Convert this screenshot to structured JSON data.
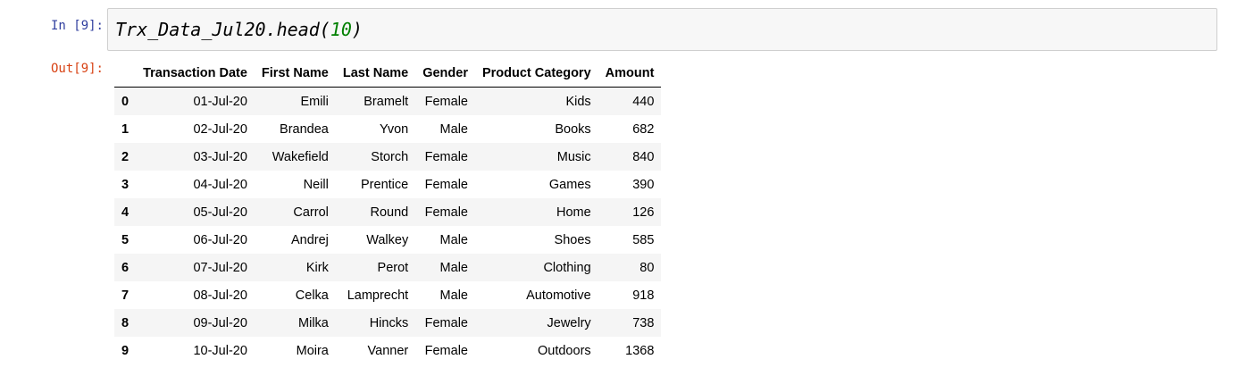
{
  "input_prompt": "In [9]:",
  "output_prompt": "Out[9]:",
  "code": {
    "prefix": "Trx_Data_Jul20.head(",
    "arg": "10",
    "suffix": ")"
  },
  "table": {
    "columns": [
      "",
      "Transaction Date",
      "First Name",
      "Last Name",
      "Gender",
      "Product Category",
      "Amount"
    ],
    "rows": [
      {
        "index": "0",
        "date": "01-Jul-20",
        "first": "Emili",
        "last": "Bramelt",
        "gender": "Female",
        "category": "Kids",
        "amount": "440"
      },
      {
        "index": "1",
        "date": "02-Jul-20",
        "first": "Brandea",
        "last": "Yvon",
        "gender": "Male",
        "category": "Books",
        "amount": "682"
      },
      {
        "index": "2",
        "date": "03-Jul-20",
        "first": "Wakefield",
        "last": "Storch",
        "gender": "Female",
        "category": "Music",
        "amount": "840"
      },
      {
        "index": "3",
        "date": "04-Jul-20",
        "first": "Neill",
        "last": "Prentice",
        "gender": "Female",
        "category": "Games",
        "amount": "390"
      },
      {
        "index": "4",
        "date": "05-Jul-20",
        "first": "Carrol",
        "last": "Round",
        "gender": "Female",
        "category": "Home",
        "amount": "126"
      },
      {
        "index": "5",
        "date": "06-Jul-20",
        "first": "Andrej",
        "last": "Walkey",
        "gender": "Male",
        "category": "Shoes",
        "amount": "585"
      },
      {
        "index": "6",
        "date": "07-Jul-20",
        "first": "Kirk",
        "last": "Perot",
        "gender": "Male",
        "category": "Clothing",
        "amount": "80"
      },
      {
        "index": "7",
        "date": "08-Jul-20",
        "first": "Celka",
        "last": "Lamprecht",
        "gender": "Male",
        "category": "Automotive",
        "amount": "918"
      },
      {
        "index": "8",
        "date": "09-Jul-20",
        "first": "Milka",
        "last": "Hincks",
        "gender": "Female",
        "category": "Jewelry",
        "amount": "738"
      },
      {
        "index": "9",
        "date": "10-Jul-20",
        "first": "Moira",
        "last": "Vanner",
        "gender": "Female",
        "category": "Outdoors",
        "amount": "1368"
      }
    ]
  }
}
